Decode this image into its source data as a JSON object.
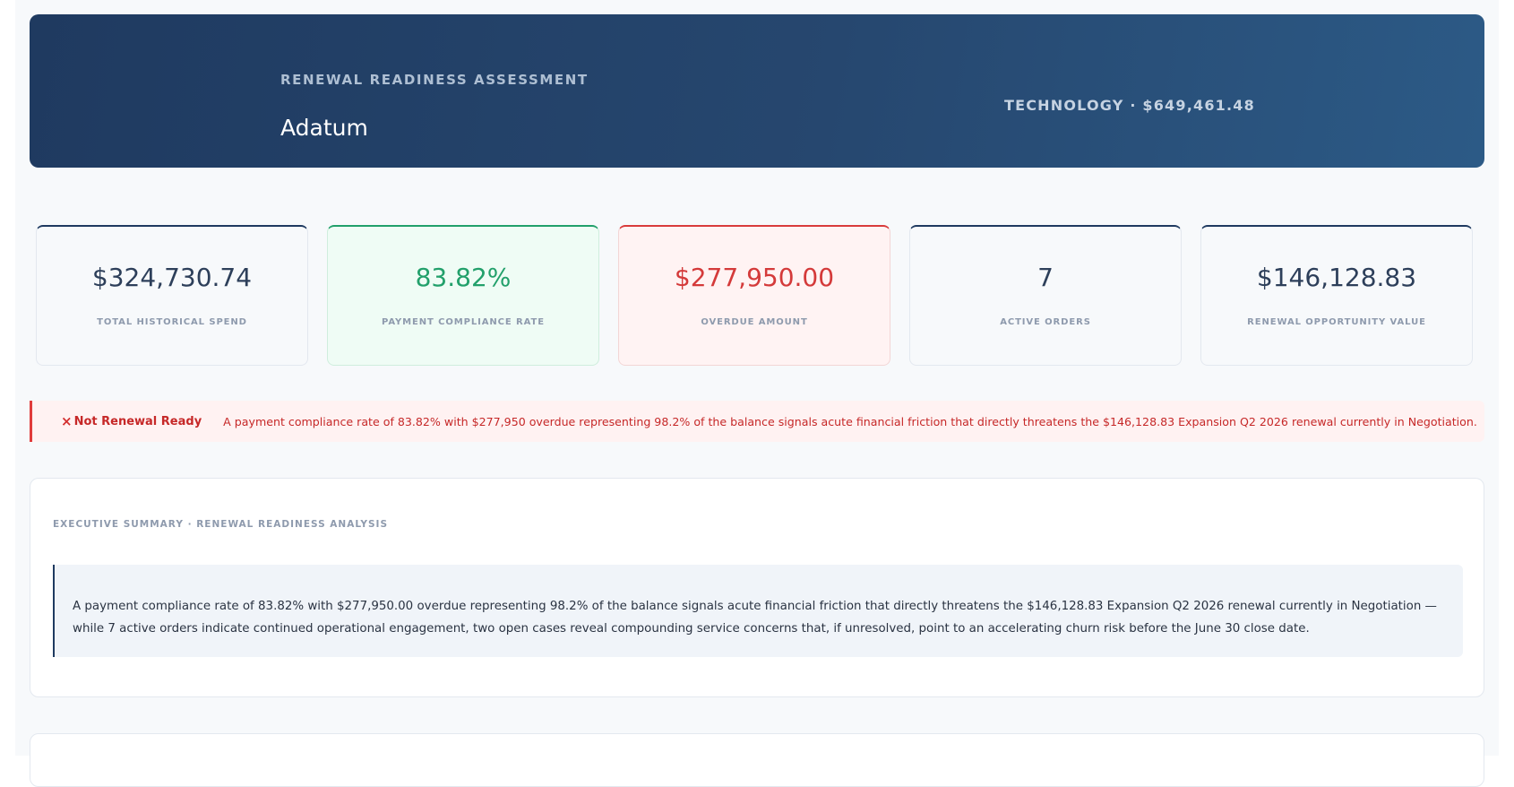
{
  "header": {
    "eyebrow": "RENEWAL READINESS ASSESSMENT",
    "account_name": "Adatum",
    "meta": "TECHNOLOGY · $649,461.48"
  },
  "kpis": [
    {
      "value": "$324,730.74",
      "label": "TOTAL HISTORICAL SPEND"
    },
    {
      "value": "83.82%",
      "label": "PAYMENT COMPLIANCE RATE"
    },
    {
      "value": "$277,950.00",
      "label": "OVERDUE AMOUNT"
    },
    {
      "value": "7",
      "label": "ACTIVE ORDERS"
    },
    {
      "value": "$146,128.83",
      "label": "RENEWAL OPPORTUNITY VALUE"
    }
  ],
  "alert": {
    "icon": "×",
    "status": "Not Renewal Ready",
    "message": "A payment compliance rate of 83.82% with $277,950 overdue representing 98.2% of the balance signals acute financial friction that directly threatens the $146,128.83 Expansion Q2 2026 renewal currently in Negotiation."
  },
  "summary": {
    "eyebrow": "EXECUTIVE SUMMARY · RENEWAL READINESS ANALYSIS",
    "text": "A payment compliance rate of 83.82% with $277,950.00 overdue representing 98.2% of the balance signals acute financial friction that directly threatens the $146,128.83 Expansion Q2 2026 renewal currently in Negotiation — while 7 active orders indicate continued operational engagement, two open cases reveal compounding service concerns that, if unresolved, point to an accelerating churn risk before the June 30 close date."
  },
  "colors": {
    "header_gradient_start": "#1f3a60",
    "header_gradient_end": "#2c5a86",
    "positive": "#22a06b",
    "negative": "#d43a3a",
    "accent": "#1f3a60"
  }
}
